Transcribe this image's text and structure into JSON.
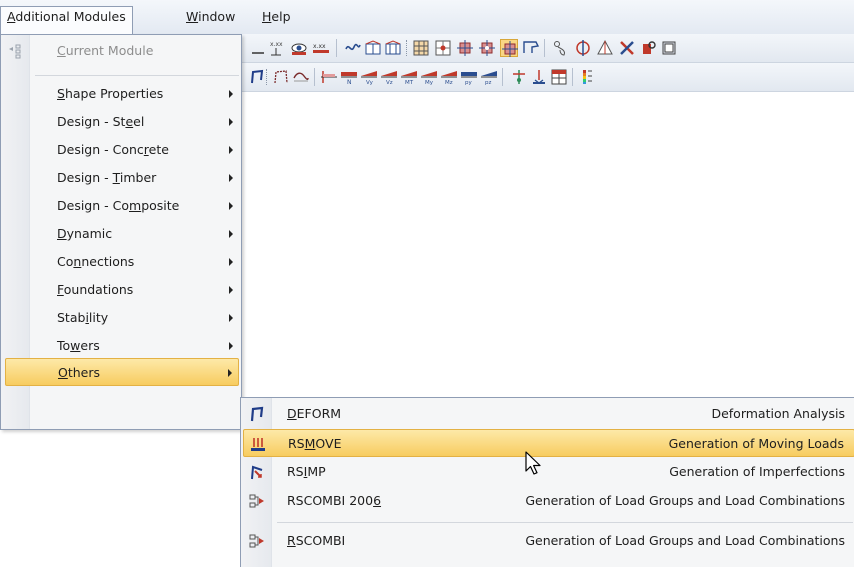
{
  "menubar": {
    "items": [
      {
        "pre": "",
        "key": "A",
        "post": "dditional Modules"
      },
      {
        "pre": "",
        "key": "W",
        "post": "indow"
      },
      {
        "pre": "",
        "key": "H",
        "post": "elp"
      }
    ]
  },
  "dropdown": {
    "current": {
      "pre": "",
      "key": "C",
      "post": "urrent Module"
    },
    "items": [
      {
        "pre": "",
        "key": "S",
        "post": "hape Properties"
      },
      {
        "pre": "Design - St",
        "key": "e",
        "post": "el"
      },
      {
        "pre": "Design - Conc",
        "key": "r",
        "post": "ete"
      },
      {
        "pre": "Design - ",
        "key": "T",
        "post": "imber"
      },
      {
        "pre": "Design - Co",
        "key": "m",
        "post": "posite"
      },
      {
        "pre": "",
        "key": "D",
        "post": "ynamic"
      },
      {
        "pre": "Co",
        "key": "n",
        "post": "nections"
      },
      {
        "pre": "",
        "key": "F",
        "post": "oundations"
      },
      {
        "pre": "Stab",
        "key": "i",
        "post": "lity"
      },
      {
        "pre": "To",
        "key": "w",
        "post": "ers"
      },
      {
        "pre": "",
        "key": "O",
        "post": "thers"
      }
    ]
  },
  "submenu": {
    "items": [
      {
        "pre": "",
        "key": "D",
        "post": "EFORM",
        "desc": "Deformation Analysis",
        "icon": "deform-icon"
      },
      {
        "pre": "RS",
        "key": "M",
        "post": "OVE",
        "desc": "Generation of Moving Loads",
        "icon": "rsmove-icon"
      },
      {
        "pre": "RS",
        "key": "I",
        "post": "MP",
        "desc": "Generation of Imperfections",
        "icon": "rsimp-icon"
      },
      {
        "pre": "RSCOMBI 200",
        "key": "6",
        "post": "",
        "desc": "Generation of Load Groups and Load Combinations",
        "icon": "rscombi-icon"
      },
      {
        "pre": "",
        "key": "R",
        "post": "SCOMBI",
        "desc": "Generation of Load Groups and Load Combinations",
        "icon": "rscombi-icon"
      }
    ]
  },
  "colors": {
    "highlight": "#f7cc60",
    "menu_bg": "#f5f6f7",
    "toolbar_bg": "#e2e8f0"
  }
}
